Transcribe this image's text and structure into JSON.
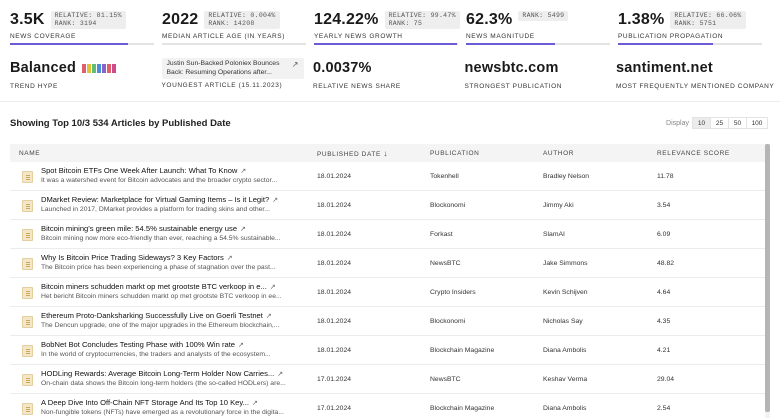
{
  "stats_row1": [
    {
      "value": "3.5K",
      "pill": [
        "RELATIVE: 81.15%",
        "RANK: 3194"
      ],
      "label": "NEWS COVERAGE",
      "fill": 0.82
    },
    {
      "value": "2022",
      "pill": [
        "RELATIVE: 0.004%",
        "RANK: 14208"
      ],
      "label": "MEDIAN ARTICLE AGE (IN YEARS)",
      "fill": 0.0
    },
    {
      "value": "124.22%",
      "pill": [
        "RELATIVE: 99.47%",
        "RANK: 75"
      ],
      "label": "YEARLY NEWS GROWTH",
      "fill": 0.995
    },
    {
      "value": "62.3%",
      "pill": [
        "RANK: 5499"
      ],
      "label": "NEWS MAGNITUDE",
      "fill": 0.62
    },
    {
      "value": "1.38%",
      "pill": [
        "RELATIVE: 66.06%",
        "RANK: 5751"
      ],
      "label": "PUBLICATION PROPAGATION",
      "fill": 0.66
    }
  ],
  "stats_row2": {
    "trend_hype": {
      "value": "Balanced",
      "label": "TREND HYPE",
      "colors": [
        "#e05f6e",
        "#e0c23a",
        "#5fbf76",
        "#4a90d9",
        "#8a63c9",
        "#e05f6e",
        "#d04b8a"
      ]
    },
    "youngest": {
      "title": "Justin Sun-Backed Poloniex Bounces Back: Resuming Operations after...",
      "label": "YOUNGEST ARTICLE (15.11.2023)",
      "link_icon": "external-link-icon"
    },
    "share": {
      "value": "0.0037%",
      "label": "RELATIVE NEWS SHARE"
    },
    "strongest": {
      "value": "newsbtc.com",
      "label": "STRONGEST PUBLICATION"
    },
    "company": {
      "value": "santiment.net",
      "label": "MOST FREQUENTLY MENTIONED COMPANY"
    }
  },
  "articles": {
    "title": "Showing Top 10/3 534 Articles by Published Date",
    "display_label": "Display",
    "display_options": [
      "10",
      "25",
      "50",
      "100"
    ],
    "active_option": "10"
  },
  "table": {
    "columns": [
      "NAME",
      "PUBLISHED DATE",
      "PUBLICATION",
      "AUTHOR",
      "RELEVANCE SCORE"
    ],
    "sort_icon": "arrow-down-icon",
    "rows": [
      {
        "title": "Spot Bitcoin ETFs One Week After Launch: What To Know",
        "snippet": "It was a watershed event for Bitcoin advocates and the broader crypto sector...",
        "date": "18.01.2024",
        "publication": "Tokenhell",
        "author": "Bradley Nelson",
        "score": "11.78"
      },
      {
        "title": "DMarket Review: Marketplace for Virtual Gaming Items – Is it Legit?",
        "snippet": "Launched in 2017, DMarket provides a platform for trading skins and other...",
        "date": "18.01.2024",
        "publication": "Blockonomi",
        "author": "Jimmy Aki",
        "score": "3.54"
      },
      {
        "title": "Bitcoin mining's green mile: 54.5% sustainable energy use",
        "snippet": "Bitcoin mining now more eco-friendly than ever, reaching a 54.5% sustainable...",
        "date": "18.01.2024",
        "publication": "Forkast",
        "author": "SlamAI",
        "score": "6.09"
      },
      {
        "title": "Why Is Bitcoin Price Trading Sideways? 3 Key Factors",
        "snippet": "The Bitcoin price has been experiencing a phase of stagnation over the past...",
        "date": "18.01.2024",
        "publication": "NewsBTC",
        "author": "Jake Simmons",
        "score": "48.82"
      },
      {
        "title": "Bitcoin miners schudden markt op met grootste BTC verkoop in e...",
        "snippet": "Het bericht Bitcoin miners schudden markt op met grootste BTC verkoop in ee...",
        "date": "18.01.2024",
        "publication": "Crypto Insiders",
        "author": "Kevin Schijven",
        "score": "4.64"
      },
      {
        "title": "Ethereum Proto-Danksharking Successfully Live on Goerli Testnet",
        "snippet": "The Dencun upgrade, one of the major upgrades in the Ethereum blockchain,...",
        "date": "18.01.2024",
        "publication": "Blockonomi",
        "author": "Nicholas Say",
        "score": "4.35"
      },
      {
        "title": "BobNet Bot Concludes Testing Phase with 100% Win rate",
        "snippet": "In the world of cryptocurrencies, the traders and analysts of the ecosystem...",
        "date": "18.01.2024",
        "publication": "Blockchain Magazine",
        "author": "Diana Ambolis",
        "score": "4.21"
      },
      {
        "title": "HODLing Rewards: Average Bitcoin Long-Term Holder Now Carries...",
        "snippet": "On-chain data shows the Bitcoin long-term holders (the so-called HODLers) are...",
        "date": "17.01.2024",
        "publication": "NewsBTC",
        "author": "Keshav Verma",
        "score": "29.04"
      },
      {
        "title": "A Deep Dive Into Off-Chain NFT Storage And Its Top 10 Key...",
        "snippet": "Non-fungible tokens (NFTs) have emerged as a revolutionary force in the digita...",
        "date": "17.01.2024",
        "publication": "Blockchain Magazine",
        "author": "Diana Ambolis",
        "score": "2.54"
      }
    ]
  }
}
